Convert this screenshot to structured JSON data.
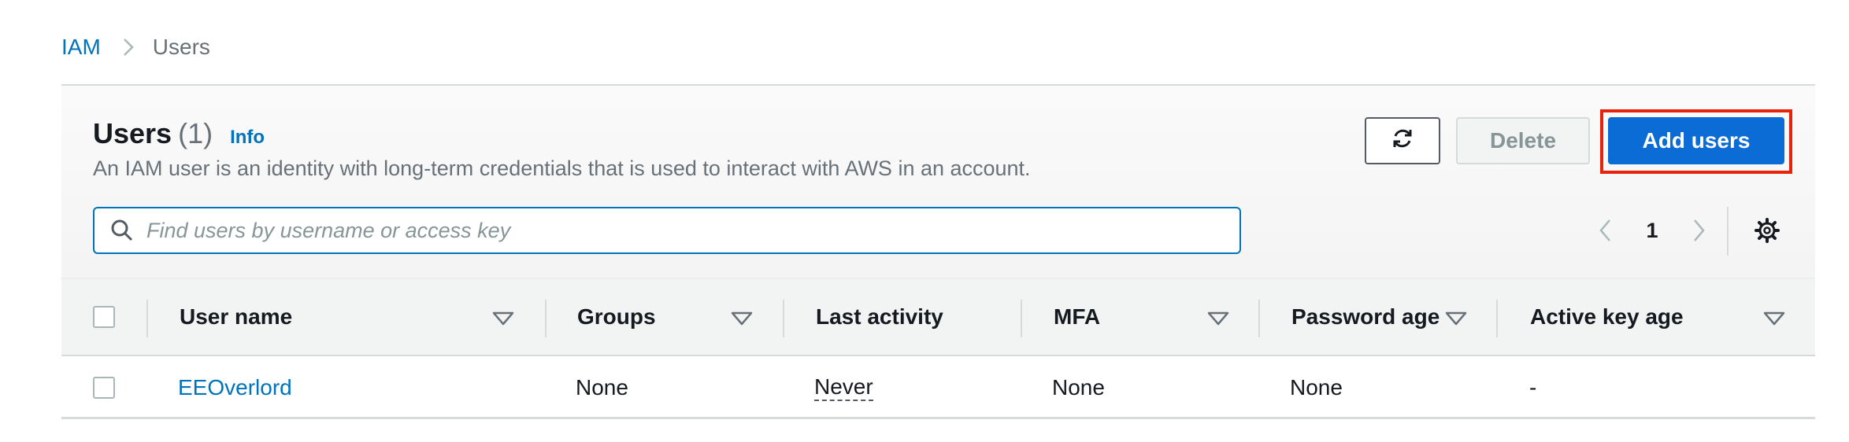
{
  "breadcrumb": {
    "root": "IAM",
    "current": "Users"
  },
  "header": {
    "title": "Users",
    "count": "(1)",
    "info": "Info",
    "description": "An IAM user is an identity with long-term credentials that is used to interact with AWS in an account."
  },
  "actions": {
    "delete": "Delete",
    "add": "Add users"
  },
  "search": {
    "placeholder": "Find users by username or access key",
    "value": ""
  },
  "pagination": {
    "page": "1"
  },
  "table": {
    "columns": [
      "User name",
      "Groups",
      "Last activity",
      "MFA",
      "Password age",
      "Active key age"
    ],
    "rows": [
      {
        "user_name": "EEOverlord",
        "groups": "None",
        "last_activity": "Never",
        "mfa": "None",
        "password_age": "None",
        "active_key_age": "-"
      }
    ]
  },
  "icons": {
    "breadcrumb_separator": "chevron-right-icon",
    "refresh": "refresh-icon",
    "search": "search-icon",
    "prev": "chevron-left-icon",
    "next": "chevron-right-icon",
    "settings": "gear-icon",
    "sort": "caret-down-icon"
  },
  "colors": {
    "link": "#0073bb",
    "primary": "#0b6cd6",
    "highlight": "#e8230c"
  }
}
